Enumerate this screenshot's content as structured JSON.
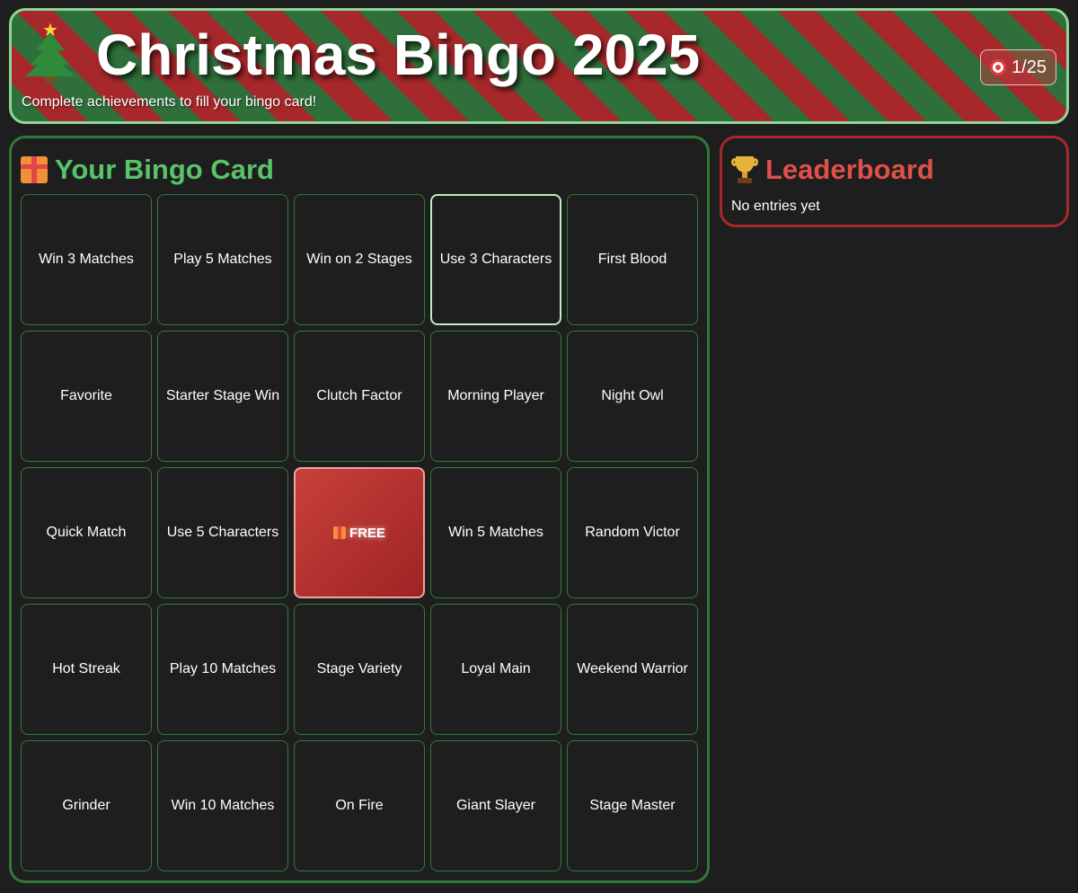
{
  "header": {
    "title": "Christmas Bingo 2025",
    "subtitle": "Complete achievements to fill your bingo card!",
    "progress": "1/25",
    "icon": "christmas-tree-icon",
    "progress_icon": "target-icon"
  },
  "bingo_card": {
    "title": "Your Bingo Card",
    "icon": "gift-icon",
    "cells": [
      {
        "label": "Win 3 Matches"
      },
      {
        "label": "Play 5 Matches"
      },
      {
        "label": "Win on 2 Stages"
      },
      {
        "label": "Use 3 Characters"
      },
      {
        "label": "First Blood"
      },
      {
        "label": "Favorite"
      },
      {
        "label": "Starter Stage Win"
      },
      {
        "label": "Clutch Factor"
      },
      {
        "label": "Morning Player"
      },
      {
        "label": "Night Owl"
      },
      {
        "label": "Quick Match"
      },
      {
        "label": "Use 5 Characters"
      },
      {
        "label": "FREE"
      },
      {
        "label": "Win 5 Matches"
      },
      {
        "label": "Random Victor"
      },
      {
        "label": "Hot Streak"
      },
      {
        "label": "Play 10 Matches"
      },
      {
        "label": "Stage Variety"
      },
      {
        "label": "Loyal Main"
      },
      {
        "label": "Weekend Warrior"
      },
      {
        "label": "Grinder"
      },
      {
        "label": "Win 10 Matches"
      },
      {
        "label": "On Fire"
      },
      {
        "label": "Giant Slayer"
      },
      {
        "label": "Stage Master"
      }
    ]
  },
  "leaderboard": {
    "title": "Leaderboard",
    "icon": "trophy-icon",
    "empty_text": "No entries yet"
  },
  "colors": {
    "background": "#1e1e1e",
    "green_accent": "#58c46a",
    "red_accent": "#e0504a",
    "stripe_green": "#2f6f3b",
    "stripe_red": "#a6282a"
  }
}
